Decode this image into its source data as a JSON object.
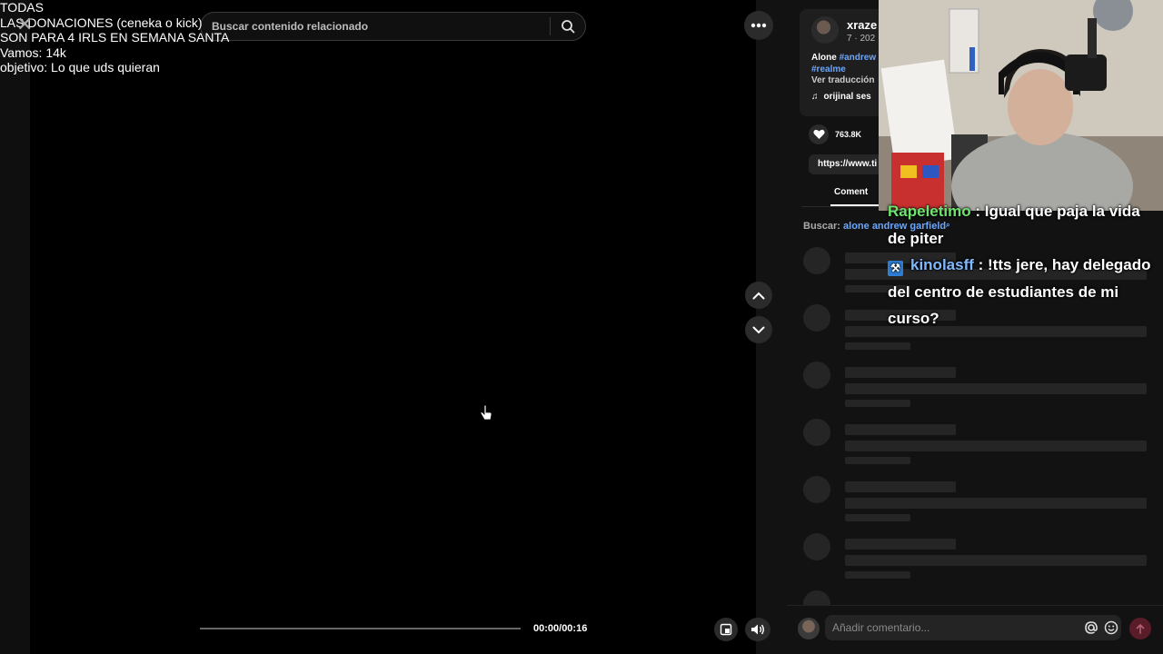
{
  "overlay": {
    "lines": [
      "TODAS",
      "LAS DONACIONES (ceneka o kick)",
      "SON PARA 4 IRLS EN SEMANA SANTA",
      "Vamos: 14k",
      "objetivo: Lo que uds quieran"
    ]
  },
  "search": {
    "placeholder": "Buscar contenido relacionado"
  },
  "player": {
    "time": "00:00/00:16",
    "progress_fraction": 0.0
  },
  "post": {
    "username": "xraze",
    "date": "7 · 202",
    "caption_text": "Alone ",
    "hashtag_1": "#andrew",
    "hashtag_2": "#realme",
    "translate": "Ver traducción",
    "music": "orijinal ses",
    "likes": "763.8K",
    "url": "https://www.ti",
    "tab_comments": "Coment"
  },
  "related": {
    "label": "Buscar:",
    "query": "alone andrew garfield"
  },
  "comment_box": {
    "placeholder": "Añadir comentario..."
  },
  "stream_chat": {
    "msg1_user": "Rapeletimo",
    "msg1_text": " : Igual que paja la vida de piter",
    "msg2_user": "kinolasff",
    "msg2_text": " : !tts jere, hay delegado del centro de estudiantes de mi curso?"
  },
  "colors": {
    "accent_blue": "#6aa6ff",
    "chat_green": "#6fe36f",
    "send_red": "#5a1c28"
  }
}
